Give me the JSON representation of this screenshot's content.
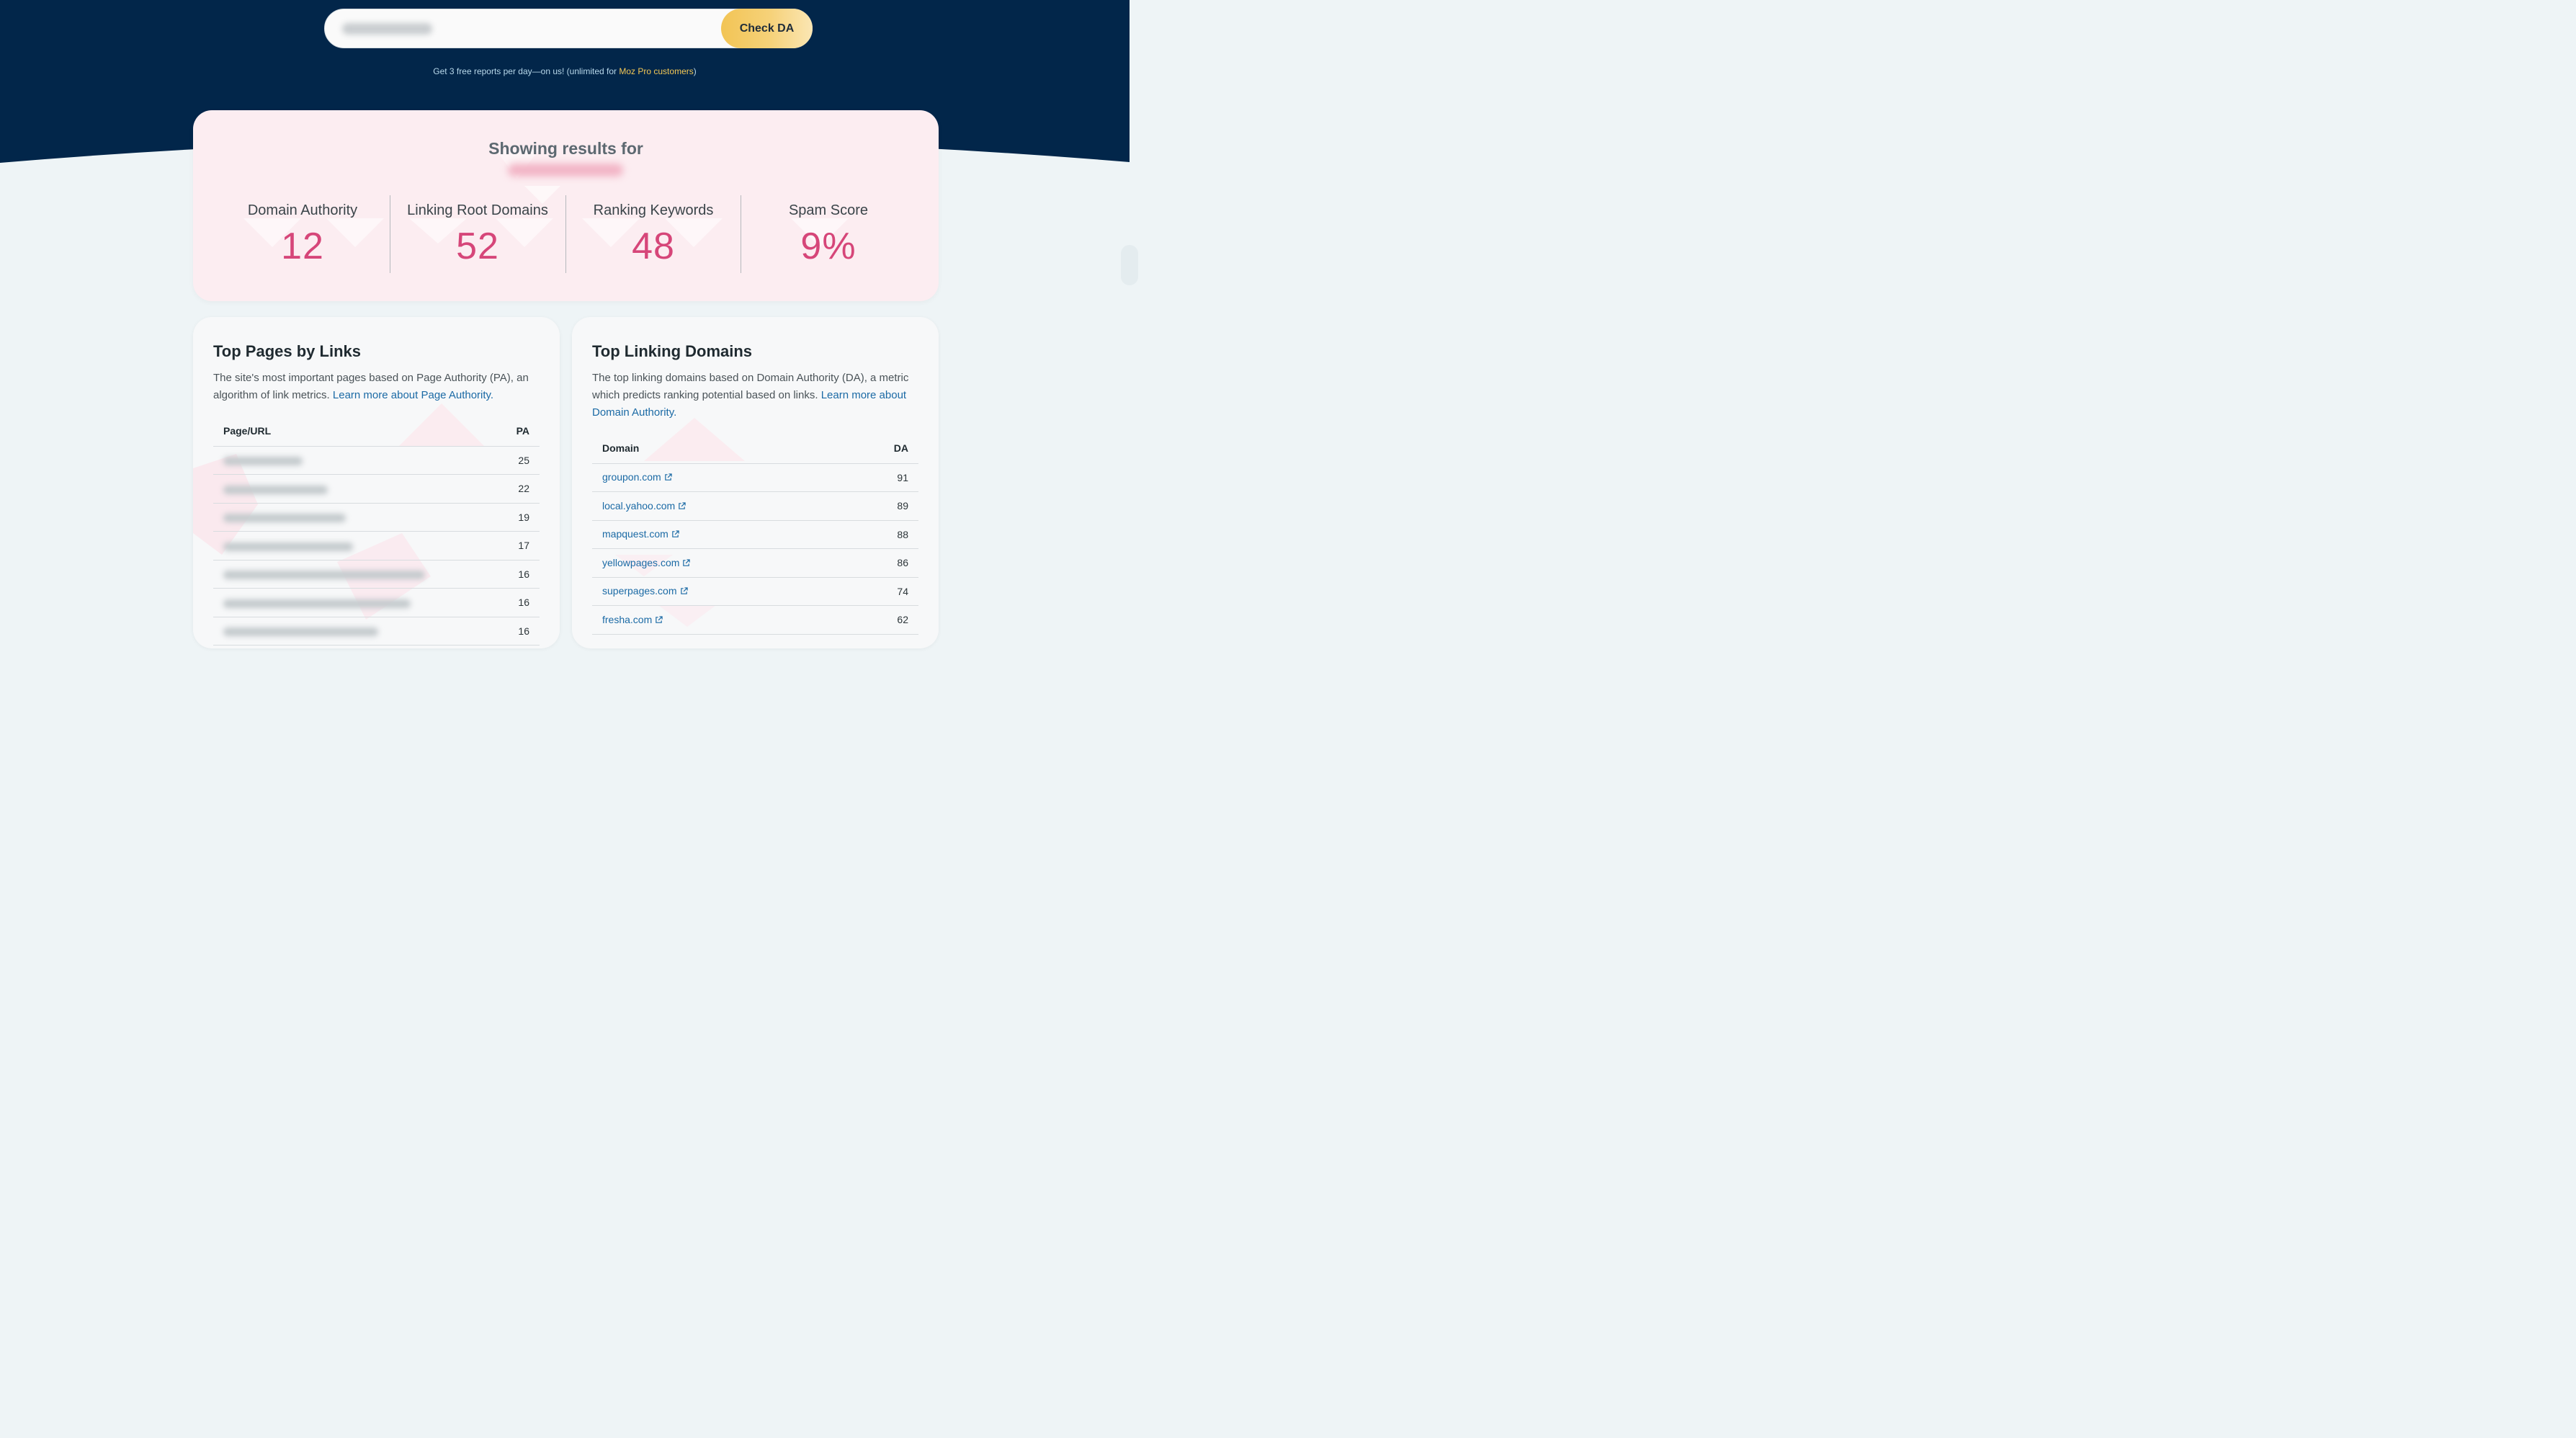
{
  "colors": {
    "hero_bg": "#02264a",
    "accent_button": "#f2c455",
    "metric_value": "#d64679",
    "link": "#1b6aa5",
    "results_card_bg": "#fcedf1"
  },
  "search": {
    "value": "",
    "button_label": "Check DA"
  },
  "promo": {
    "text": "Get 3 free reports per day—on us! (unlimited for ",
    "link_label": "Moz Pro customers",
    "suffix": ")"
  },
  "results": {
    "heading": "Showing results for",
    "domain": "",
    "metrics": [
      {
        "label": "Domain Authority",
        "value": "12"
      },
      {
        "label": "Linking Root Domains",
        "value": "52"
      },
      {
        "label": "Ranking Keywords",
        "value": "48"
      },
      {
        "label": "Spam Score",
        "value": "9%"
      }
    ]
  },
  "top_pages": {
    "title": "Top Pages by Links",
    "desc": "The site's most important pages based on Page Authority (PA), an algorithm of link metrics. ",
    "link_label": "Learn more about Page Authority.",
    "columns": [
      "Page/URL",
      "PA"
    ],
    "rows": [
      {
        "url": "",
        "pa": "25"
      },
      {
        "url": "",
        "pa": "22"
      },
      {
        "url": "",
        "pa": "19"
      },
      {
        "url": "",
        "pa": "17"
      },
      {
        "url": "",
        "pa": "16"
      },
      {
        "url": "",
        "pa": "16"
      },
      {
        "url": "",
        "pa": "16"
      }
    ]
  },
  "top_domains": {
    "title": "Top Linking Domains",
    "desc": "The top linking domains based on Domain Authority (DA), a metric which predicts ranking potential based on links. ",
    "link_label": "Learn more about Domain Authority.",
    "columns": [
      "Domain",
      "DA"
    ],
    "rows": [
      {
        "domain": "groupon.com",
        "da": "91"
      },
      {
        "domain": "local.yahoo.com",
        "da": "89"
      },
      {
        "domain": "mapquest.com",
        "da": "88"
      },
      {
        "domain": "yellowpages.com",
        "da": "86"
      },
      {
        "domain": "superpages.com",
        "da": "74"
      },
      {
        "domain": "fresha.com",
        "da": "62"
      }
    ]
  }
}
